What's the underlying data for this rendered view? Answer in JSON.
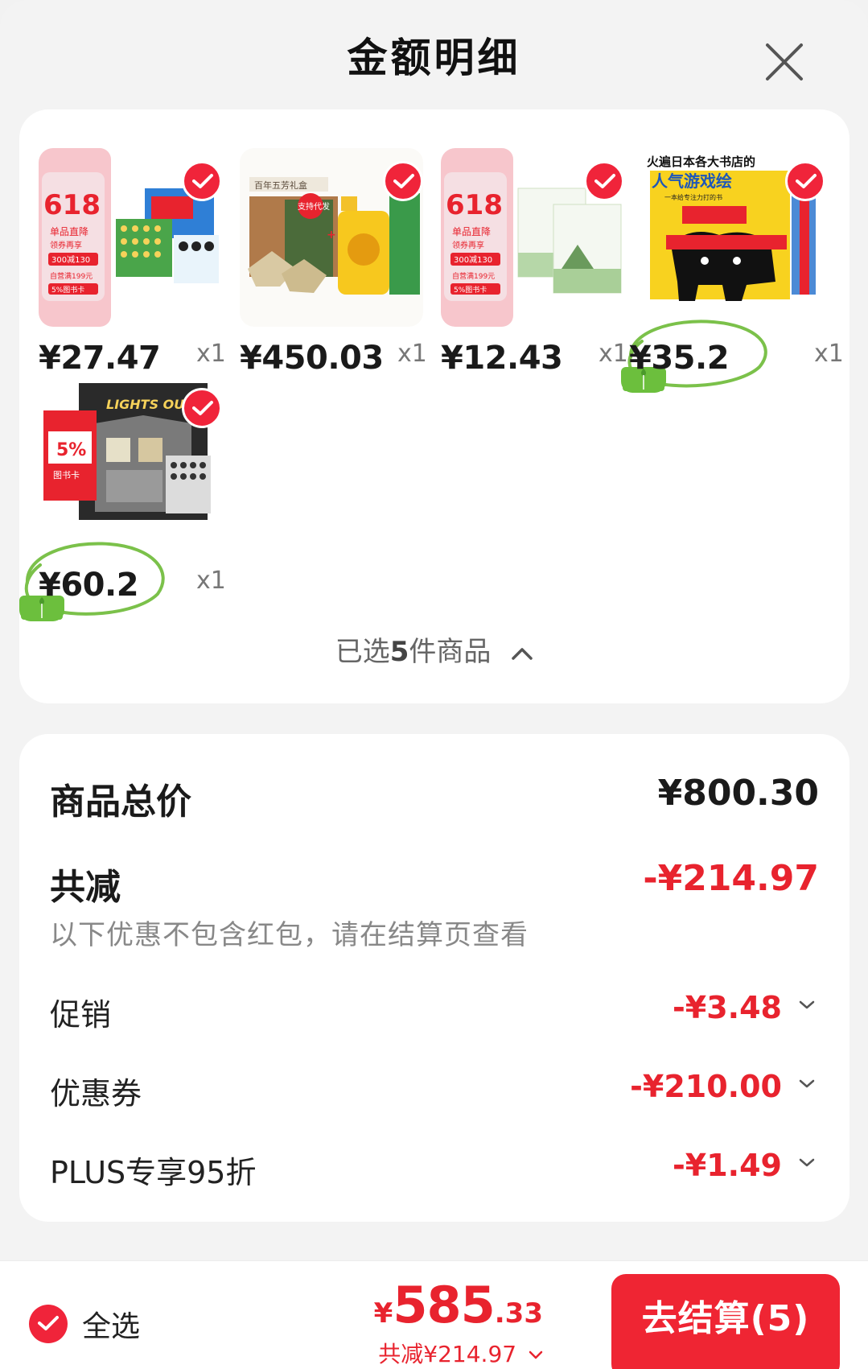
{
  "header": {
    "title": "金额明细"
  },
  "products": [
    {
      "price": "¥27.47",
      "qty": "x1"
    },
    {
      "price": "¥450.03",
      "qty": "x1"
    },
    {
      "price": "¥12.43",
      "qty": "x1"
    },
    {
      "price": "¥35.2",
      "qty": "x1"
    },
    {
      "price": "¥60.2",
      "qty": "x1"
    }
  ],
  "product_images": {
    "p1_badge": "618",
    "p1_line1": "单品直降",
    "p1_line2": "领券再享",
    "p1_line3": "300减130",
    "p1_line4": "自营满199元",
    "p1_line5": "5%图书卡",
    "p2_box": "百年五芳礼盒",
    "p2_tag": "支持代发",
    "p4_top": "火遍日本各大书店的",
    "p4_title": "人气游戏绘",
    "p4_sub": "一本给专注力打的书",
    "p5_title": "LIGHTS OUT",
    "p5_card": "5%",
    "p5_card_label": "图书卡"
  },
  "selection": {
    "prefix": "已选",
    "count": "5",
    "suffix": "件商品"
  },
  "summary": {
    "total_label": "商品总价",
    "total_value": "¥800.30",
    "reduce_label": "共减",
    "reduce_value": "-¥214.97",
    "hint": "以下优惠不包含红包，请在结算页查看",
    "items": [
      {
        "label": "促销",
        "value": "-¥3.48"
      },
      {
        "label": "优惠券",
        "value": "-¥210.00"
      },
      {
        "label": "PLUS专享95折",
        "value": "-¥1.49"
      }
    ]
  },
  "bottom": {
    "select_all": "全选",
    "currency": "¥",
    "amount_int": "585",
    "amount_dec": ".33",
    "saved": "共减¥214.97",
    "checkout": "去结算(5)"
  },
  "colors": {
    "accent": "#ef2533",
    "eco_green": "#6cbf3d"
  }
}
